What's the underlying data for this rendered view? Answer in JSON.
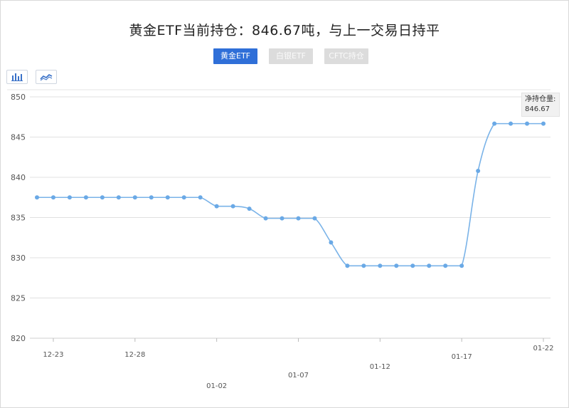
{
  "title": "黄金ETF当前持仓：846.67吨，与上一交易日持平",
  "tabs": [
    {
      "label": "黄金ETF",
      "active": true
    },
    {
      "label": "白银ETF",
      "active": false
    },
    {
      "label": "CFTC持仓",
      "active": false
    }
  ],
  "toolbar": {
    "bar_icon": "bar-chart-icon",
    "line_icon": "line-chart-icon"
  },
  "tooltip": {
    "label": "净持仓量:",
    "value": "846.67"
  },
  "colors": {
    "line": "#7ab3e8",
    "point": "#6aa9e6",
    "tab_active": "#2f6fd8",
    "grid": "#e0e0e0"
  },
  "chart_data": {
    "type": "line",
    "title": "黄金ETF当前持仓：846.67吨，与上一交易日持平",
    "xlabel": "",
    "ylabel": "",
    "ylim": [
      820,
      850
    ],
    "yticks": [
      "820",
      "825",
      "830",
      "835",
      "840",
      "845",
      "850"
    ],
    "grid": true,
    "x": [
      "12-22",
      "12-23",
      "12-24",
      "12-25",
      "12-26",
      "12-27",
      "12-28",
      "12-29",
      "12-30",
      "12-31",
      "01-01",
      "01-02",
      "01-03",
      "01-04",
      "01-05",
      "01-06",
      "01-07",
      "01-08",
      "01-09",
      "01-10",
      "01-11",
      "01-12",
      "01-13",
      "01-14",
      "01-15",
      "01-16",
      "01-17",
      "01-18",
      "01-19",
      "01-20",
      "01-21",
      "01-22"
    ],
    "xtick_labels": [
      "12-23",
      "12-28",
      "01-02",
      "01-07",
      "01-12",
      "01-17",
      "01-22"
    ],
    "series": [
      {
        "values": [
          837.5,
          837.5,
          837.5,
          837.5,
          837.5,
          837.5,
          837.5,
          837.5,
          837.5,
          837.5,
          837.5,
          836.4,
          836.4,
          836.1,
          834.9,
          834.9,
          834.9,
          834.9,
          831.9,
          829.0,
          829.0,
          829.0,
          829.0,
          829.0,
          829.0,
          829.0,
          829.0,
          840.8,
          846.67,
          846.67,
          846.67,
          846.67
        ]
      }
    ]
  }
}
